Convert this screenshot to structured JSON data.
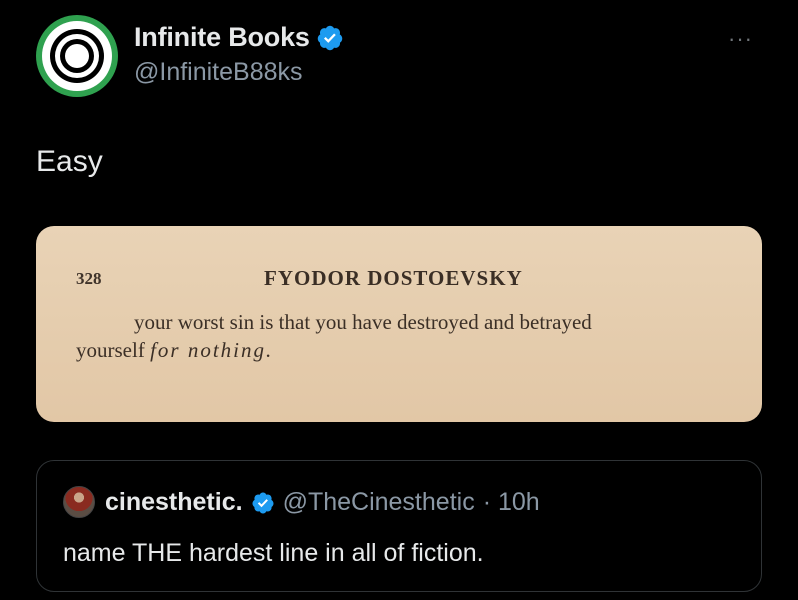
{
  "author": {
    "display_name": "Infinite Books",
    "handle": "@InfiniteB88ks",
    "verified": true
  },
  "more_label": "···",
  "tweet": {
    "text": "Easy"
  },
  "media": {
    "page_number": "328",
    "book_title": "FYODOR DOSTOEVSKY",
    "quote_line1": "your worst sin is that you have destroyed and betrayed",
    "quote_line2_start": "yourself ",
    "quote_line2_italic": "for nothing."
  },
  "quoted_tweet": {
    "display_name": "cinesthetic.",
    "handle": "@TheCinesthetic",
    "time": "· 10h",
    "text": "name THE hardest line in all of fiction."
  },
  "colors": {
    "verified_blue": "#1d9bf0",
    "avatar_green": "#2fa14f",
    "background": "#000000",
    "secondary_text": "#8b98a5"
  }
}
